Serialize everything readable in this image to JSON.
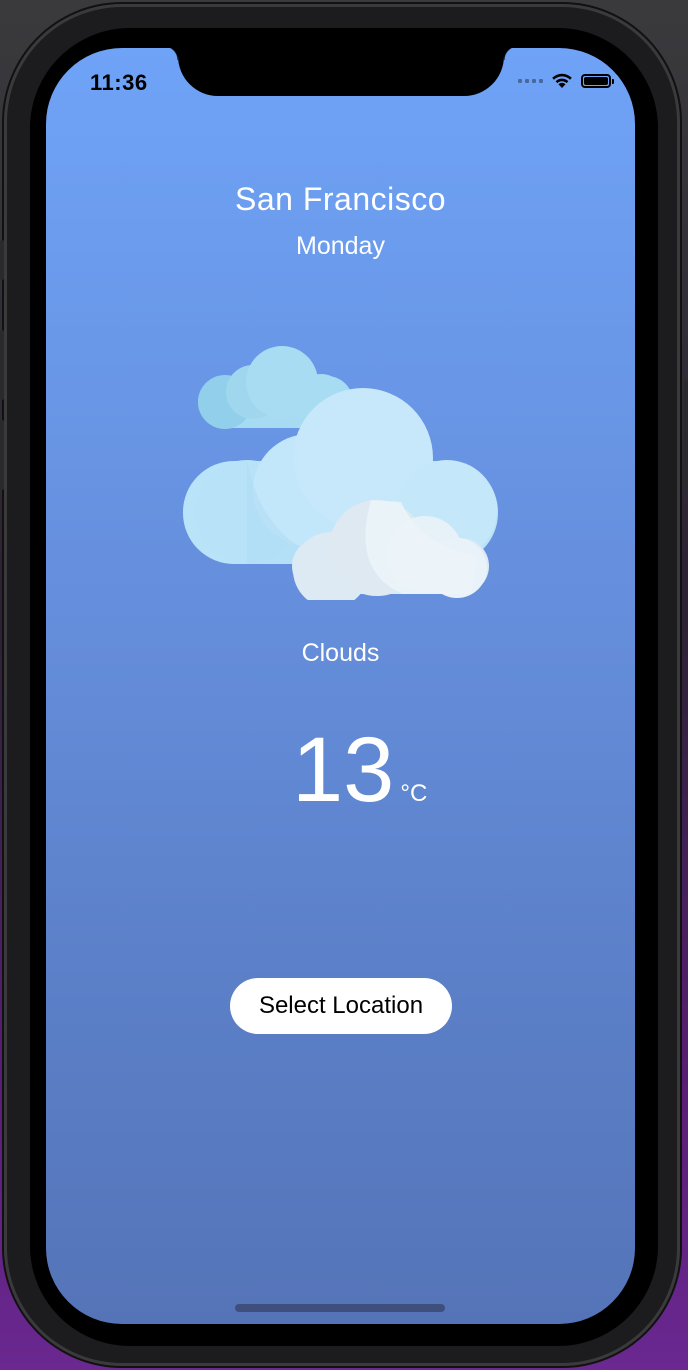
{
  "status_bar": {
    "time": "11:36"
  },
  "weather": {
    "city": "San Francisco",
    "day": "Monday",
    "condition": "Clouds",
    "temperature": "13",
    "unit": "°C",
    "icon": "clouds-icon"
  },
  "actions": {
    "select_location_label": "Select Location"
  },
  "colors": {
    "background_top": "#6fa3f7",
    "background_bottom": "#5574b8",
    "button_background": "#ffffff",
    "text": "#ffffff"
  }
}
